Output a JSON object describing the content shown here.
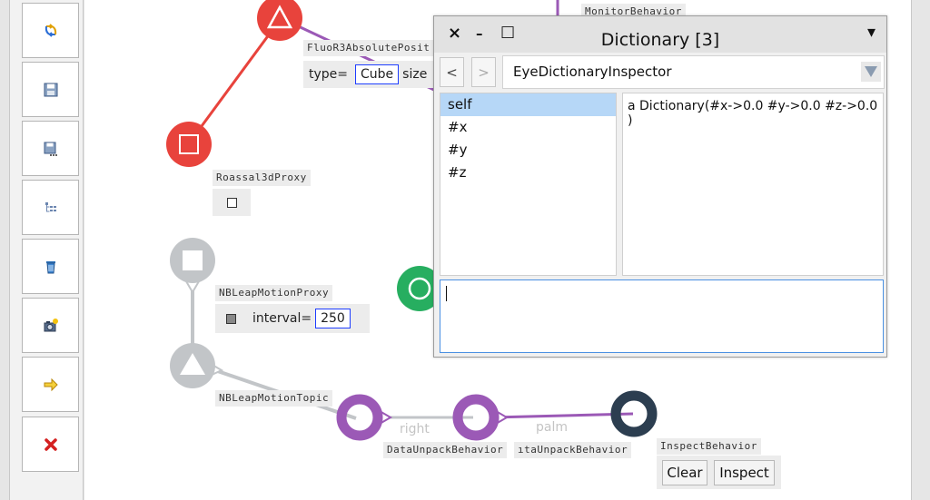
{
  "toolbar": {
    "buttons": [
      {
        "name": "refresh-tool-button",
        "icon": "refresh-icon"
      },
      {
        "name": "save-tool-button",
        "icon": "save-icon"
      },
      {
        "name": "save-as-tool-button",
        "icon": "save-as-icon"
      },
      {
        "name": "hierarchy-tool-button",
        "icon": "tree-icon"
      },
      {
        "name": "delete-tool-button",
        "icon": "trash-icon"
      },
      {
        "name": "snapshot-tool-button",
        "icon": "camera-icon"
      },
      {
        "name": "forward-tool-button",
        "icon": "arrow-right-icon"
      },
      {
        "name": "remove-tool-button",
        "icon": "red-x-icon"
      }
    ]
  },
  "canvas": {
    "tags": {
      "monitor_behavior": "MonitorBehavior",
      "fluo_absolute_position": "FluoR3AbsolutePosit",
      "roassal3d_proxy": "Roassal3dProxy",
      "nb_leap_motion_proxy": "NBLeapMotionProxy",
      "nb_leap_motion_topic": "NBLeapMotionTopic",
      "data_unpack_behavior_1": "DataUnpackBehavior",
      "data_unpack_behavior_2": "ıtaUnpackBehavior",
      "inspect_behavior": "InspectBehavior"
    },
    "fluo_params": {
      "type_label": "type=",
      "type_value": "Cube",
      "size_label": "size"
    },
    "leap_params": {
      "interval_label": "interval=",
      "interval_value": "250"
    },
    "edge_labels": {
      "right": "right",
      "palm": "palm"
    },
    "inspect_buttons": {
      "clear": "Clear",
      "inspect": "Inspect"
    },
    "colors": {
      "red": "#e8433c",
      "gray": "#c2c5c8",
      "purple": "#9b59b6",
      "green": "#27ae60",
      "navy": "#2c3e50"
    }
  },
  "window": {
    "title": "Dictionary [3]",
    "close_glyph": "×",
    "minimize_glyph": "–",
    "maximize_glyph": "□",
    "menu_glyph": "▾",
    "nav_back": "<",
    "nav_forward": ">",
    "inspector_type": "EyeDictionaryInspector",
    "items": [
      "self",
      "#x",
      "#y",
      "#z"
    ],
    "selected_index": 0,
    "value_text": "a Dictionary(#x->0.0 #y->0.0 #z->0.0 )",
    "eval_text": ""
  }
}
